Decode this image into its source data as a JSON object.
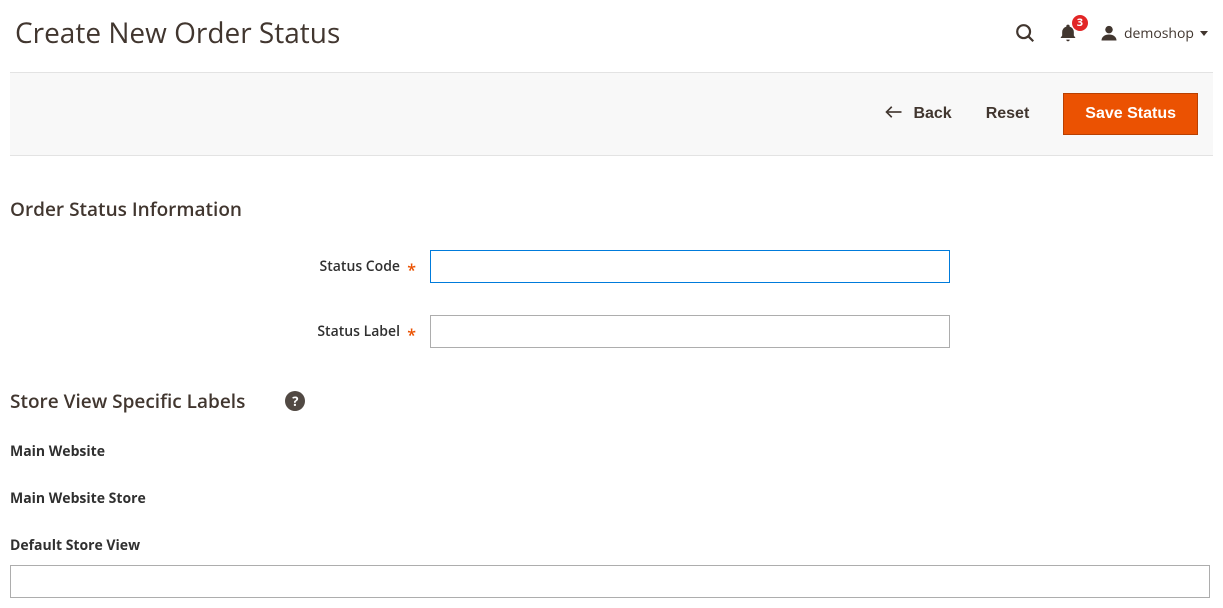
{
  "header": {
    "title": "Create New Order Status",
    "notification_count": "3",
    "username": "demoshop"
  },
  "actions": {
    "back": "Back",
    "reset": "Reset",
    "save": "Save Status"
  },
  "sections": {
    "order_status_info": {
      "title": "Order Status Information",
      "fields": {
        "status_code": {
          "label": "Status Code",
          "value": ""
        },
        "status_label": {
          "label": "Status Label",
          "value": ""
        }
      }
    },
    "store_labels": {
      "title": "Store View Specific Labels",
      "website": "Main Website",
      "store": "Main Website Store",
      "view": {
        "label": "Default Store View",
        "value": ""
      }
    }
  }
}
